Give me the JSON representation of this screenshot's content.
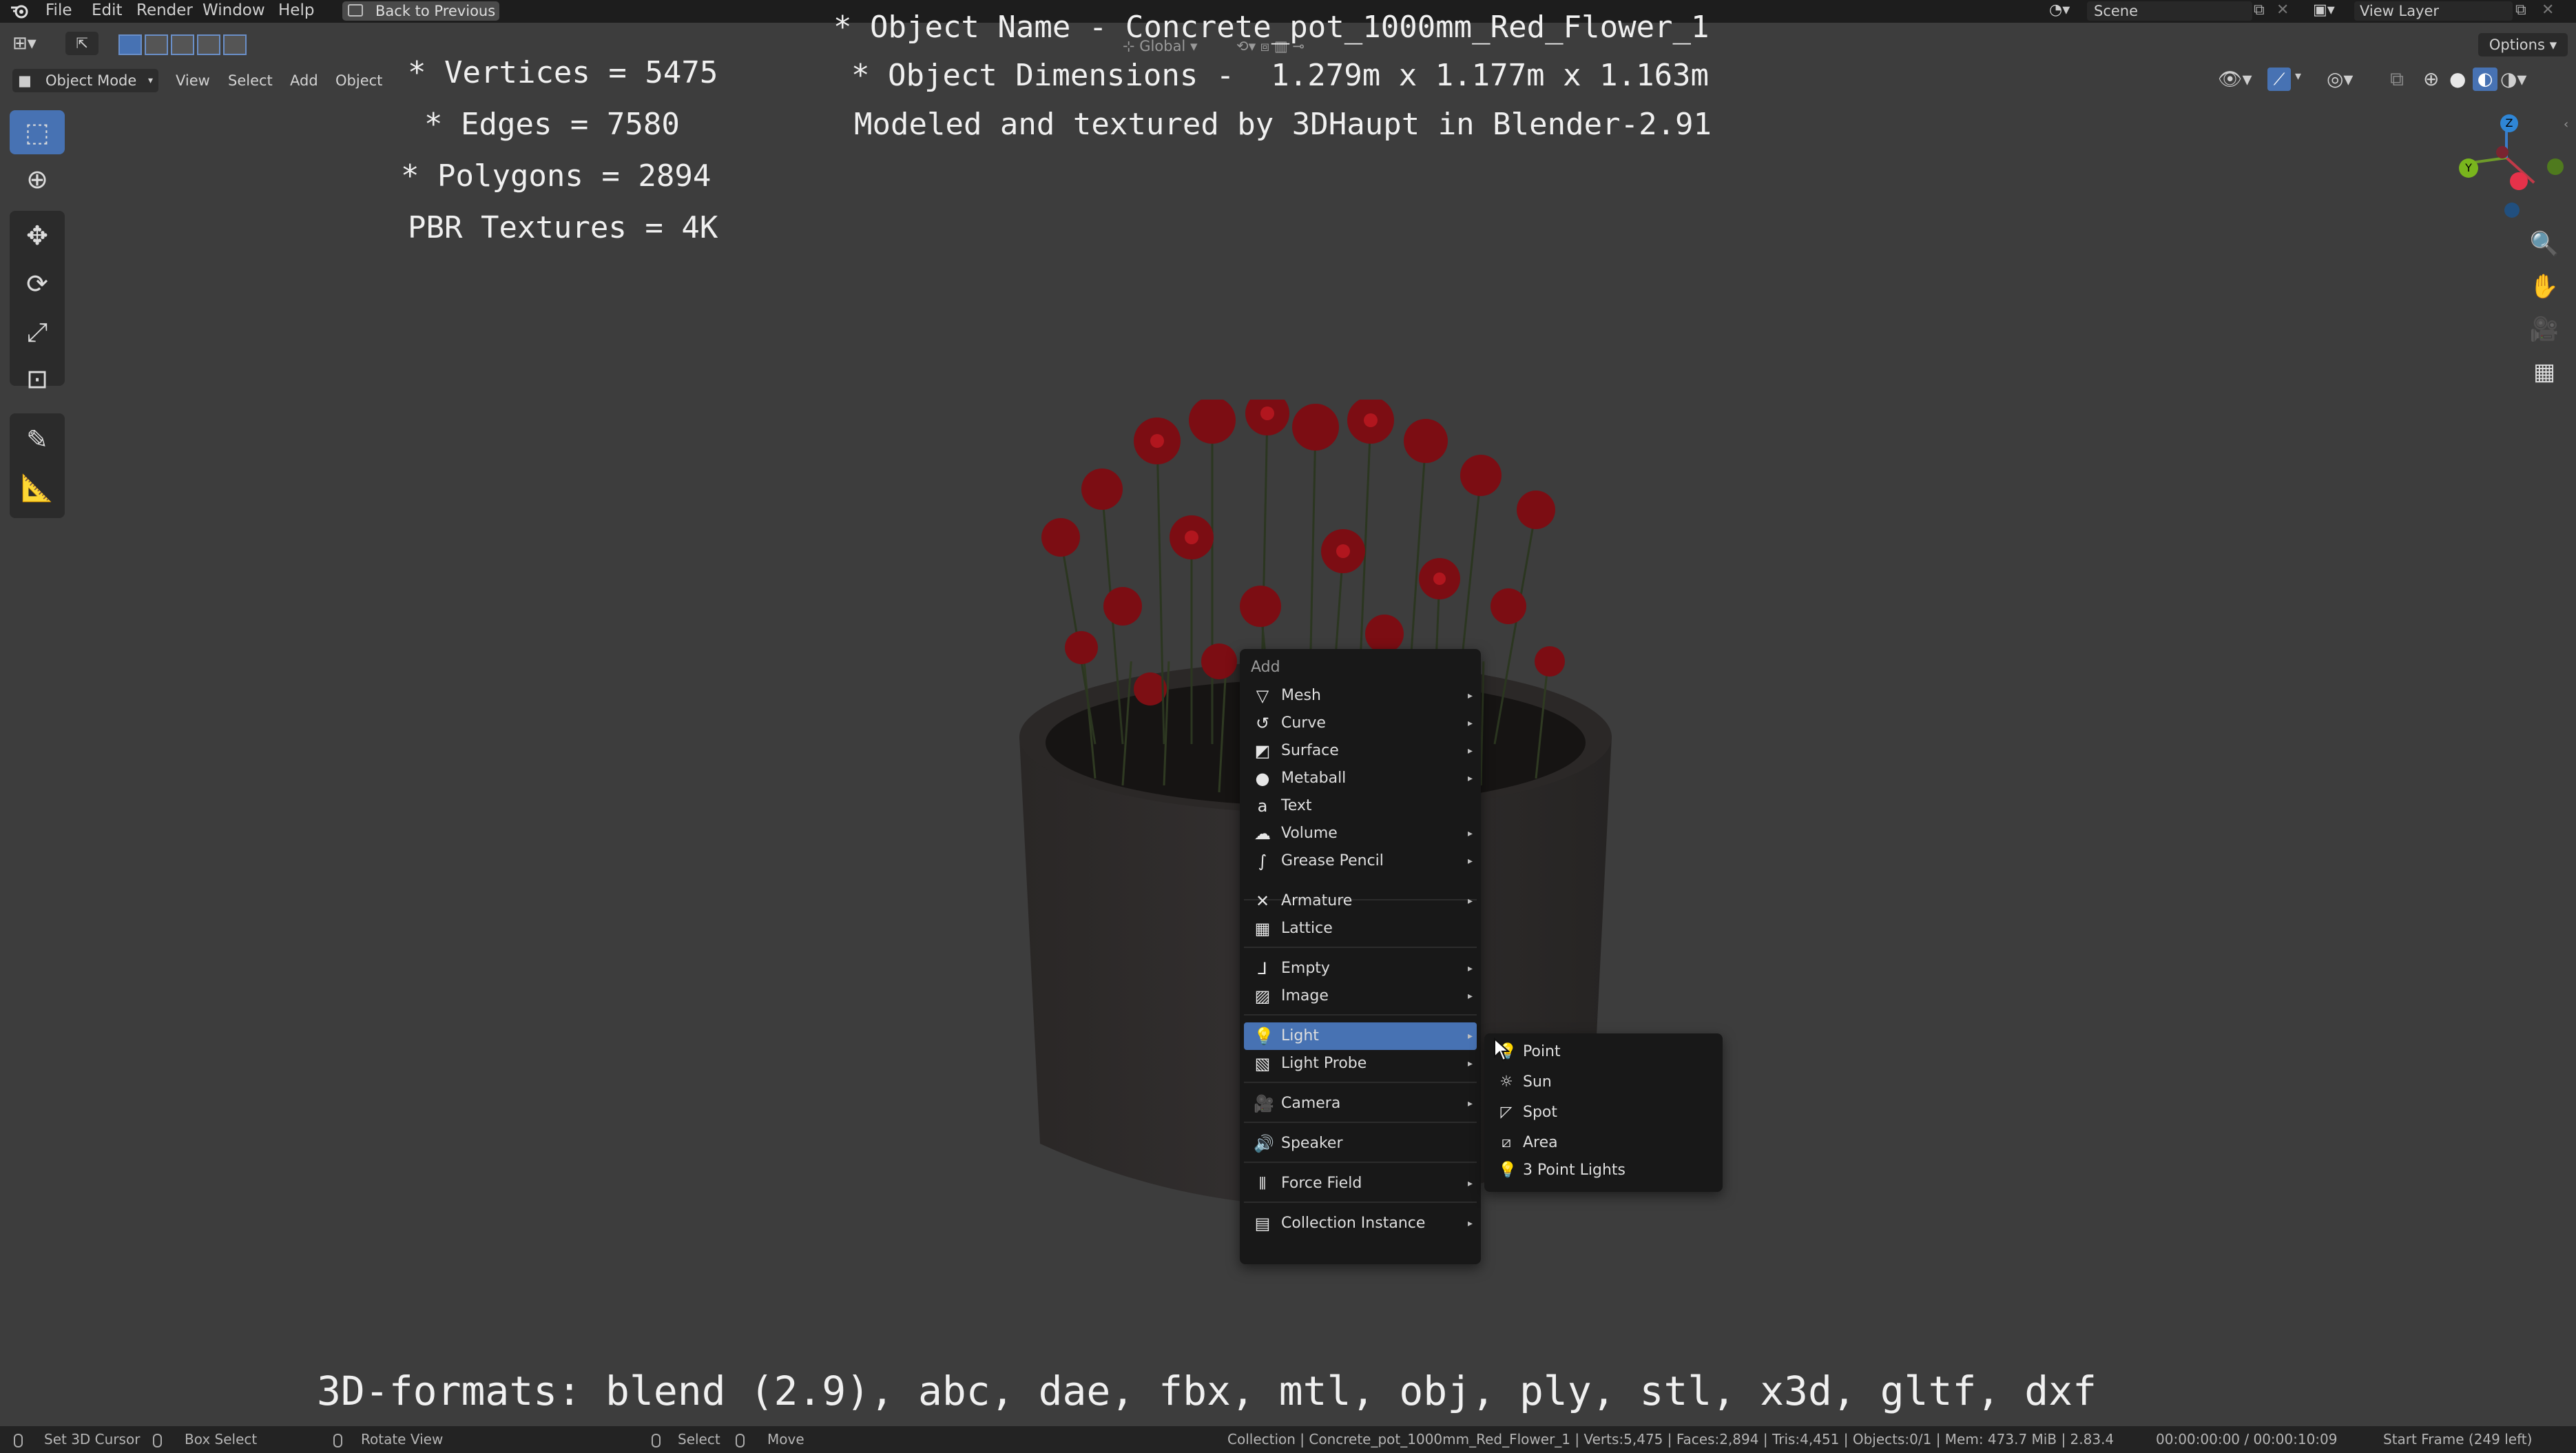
{
  "topbar": {
    "menus": [
      "File",
      "Edit",
      "Render",
      "Window",
      "Help"
    ],
    "back_button": "Back to Previous",
    "scene_label": "Scene",
    "view_layer_label": "View Layer"
  },
  "header": {
    "mode_label": "Object Mode",
    "menus": [
      "View",
      "Select",
      "Add",
      "Object"
    ],
    "orientation_label": "Global",
    "options_label": "Options"
  },
  "overlay": {
    "vertices": "* Vertices = 5475",
    "edges": "* Edges = 7580",
    "polygons": "* Polygons = 2894",
    "textures": "PBR Textures = 4K",
    "object_name": "* Object Name - Concrete_pot_1000mm_Red_Flower_1",
    "object_dimensions": "* Object Dimensions -  1.279m x 1.177m x 1.163m",
    "credit": "Modeled and textured by 3DHaupt in Blender-2.91",
    "formats": "3D-formats: blend (2.9), abc, dae, fbx, mtl, obj, ply, stl, x3d, gltf, dxf"
  },
  "add_menu": {
    "title": "Add",
    "items": [
      {
        "label": "Mesh",
        "icon": "mesh-icon",
        "submenu": true
      },
      {
        "label": "Curve",
        "icon": "curve-icon",
        "submenu": true
      },
      {
        "label": "Surface",
        "icon": "surface-icon",
        "submenu": true
      },
      {
        "label": "Metaball",
        "icon": "metaball-icon",
        "submenu": true
      },
      {
        "label": "Text",
        "icon": "text-icon",
        "submenu": false
      },
      {
        "label": "Volume",
        "icon": "volume-icon",
        "submenu": true
      },
      {
        "label": "Grease Pencil",
        "icon": "grease-pencil-icon",
        "submenu": true
      },
      {
        "label": "Armature",
        "icon": "armature-icon",
        "submenu": true
      },
      {
        "label": "Lattice",
        "icon": "lattice-icon",
        "submenu": false
      },
      {
        "label": "Empty",
        "icon": "empty-icon",
        "submenu": true
      },
      {
        "label": "Image",
        "icon": "image-icon",
        "submenu": true
      },
      {
        "label": "Light",
        "icon": "light-icon",
        "submenu": true,
        "highlighted": true
      },
      {
        "label": "Light Probe",
        "icon": "light-probe-icon",
        "submenu": true
      },
      {
        "label": "Camera",
        "icon": "camera-icon",
        "submenu": true
      },
      {
        "label": "Speaker",
        "icon": "speaker-icon",
        "submenu": false
      },
      {
        "label": "Force Field",
        "icon": "force-field-icon",
        "submenu": true
      },
      {
        "label": "Collection Instance",
        "icon": "collection-instance-icon",
        "submenu": true
      }
    ]
  },
  "light_submenu": {
    "items": [
      {
        "label": "Point",
        "icon": "point-light-icon"
      },
      {
        "label": "Sun",
        "icon": "sun-light-icon"
      },
      {
        "label": "Spot",
        "icon": "spot-light-icon"
      },
      {
        "label": "Area",
        "icon": "area-light-icon"
      },
      {
        "label": "3 Point Lights",
        "icon": "three-point-lights-icon"
      }
    ]
  },
  "statusbar": {
    "set_cursor": "Set 3D Cursor",
    "box_select": "Box Select",
    "rotate_view": "Rotate View",
    "select": "Select",
    "move": "Move",
    "scene_info": "Collection | Concrete_pot_1000mm_Red_Flower_1 | Verts:5,475 | Faces:2,894 | Tris:4,451 | Objects:0/1 | Mem: 473.7 MiB | 2.83.4",
    "timecode": "00:00:00:00 / 00:00:10:09",
    "start_frame": "Start Frame (249 left)"
  },
  "colors": {
    "viewport_bg": "#3d3d3d",
    "menu_bg": "#181818",
    "highlight": "#4772b3",
    "flower_red": "#8a0e14"
  }
}
